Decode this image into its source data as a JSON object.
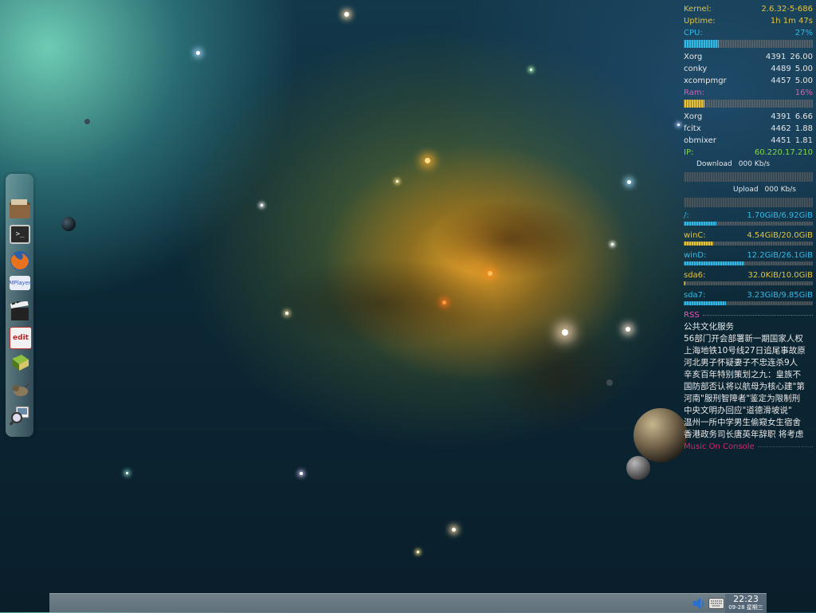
{
  "conky": {
    "kernel_label": "Kernel:",
    "kernel_value": "2.6.32-5-686",
    "uptime_label": "Uptime:",
    "uptime_value": "1h 1m 47s",
    "cpu_label": "CPU:",
    "cpu_value": "27%",
    "cpu_percent": 27,
    "cpu_procs": [
      {
        "name": "Xorg",
        "pid": "4391",
        "val": "26.00"
      },
      {
        "name": "conky",
        "pid": "4489",
        "val": "5.00"
      },
      {
        "name": "xcompmgr",
        "pid": "4457",
        "val": "5.00"
      }
    ],
    "ram_label": "Ram:",
    "ram_value": "16%",
    "ram_percent": 16,
    "ram_procs": [
      {
        "name": "Xorg",
        "pid": "4391",
        "val": "6.66"
      },
      {
        "name": "fcitx",
        "pid": "4462",
        "val": "1.88"
      },
      {
        "name": "obmixer",
        "pid": "4451",
        "val": "1.81"
      }
    ],
    "ip_label": "IP:",
    "ip_value": "60.220.17.210",
    "download_label": "Download",
    "download_value": "000 Kb/s",
    "upload_label": "Upload",
    "upload_value": "000 Kb/s",
    "disks": [
      {
        "name": "/:",
        "usage": "1.70GiB/6.92GiB",
        "fraction": 0.25,
        "color": "#34b9e6"
      },
      {
        "name": "winC:",
        "usage": "4.54GiB/20.0GiB",
        "fraction": 0.23,
        "color": "#e3c23e"
      },
      {
        "name": "winD:",
        "usage": "12.2GiB/26.1GiB",
        "fraction": 0.47,
        "color": "#34b9e6"
      },
      {
        "name": "sda6:",
        "usage": "32.0KiB/10.0GiB",
        "fraction": 0.01,
        "color": "#e3c23e"
      },
      {
        "name": "sda7:",
        "usage": "3.23GiB/9.85GiB",
        "fraction": 0.33,
        "color": "#34b9e6"
      }
    ],
    "rss_label": "RSS",
    "rss_items": [
      "公共文化服务",
      "56部门开会部署新一期国家人权",
      "上海地铁10号线27日追尾事故原",
      "河北男子怀疑妻子不忠连杀9人",
      "辛亥百年特别策划之九：皇族不",
      "国防部否认将以航母为核心建\"第",
      "河南\"服刑智障者\"鉴定为限制刑",
      "中央文明办回应\"道德滑坡说\"",
      "温州一所中学男生偷窥女生宿舍",
      "香港政务司长唐英年辞职 将考虑"
    ],
    "moc_label": "Music On Console"
  },
  "dock": {
    "icons": [
      "file-manager-icon",
      "terminal-icon",
      "firefox-icon",
      "media-player-icon",
      "video-editor-icon",
      "text-editor-icon",
      "book-icon",
      "gimp-icon",
      "image-viewer-icon"
    ]
  },
  "taskbar": {
    "clock_time": "22:23",
    "clock_date": "09-28 星期三",
    "tray_icons": [
      "volume-icon",
      "keyboard-icon"
    ]
  },
  "colors": {
    "yellow": "#e3c23e",
    "cyan": "#34b9e6",
    "magenta": "#e05ab5",
    "green": "#7fd84c"
  }
}
